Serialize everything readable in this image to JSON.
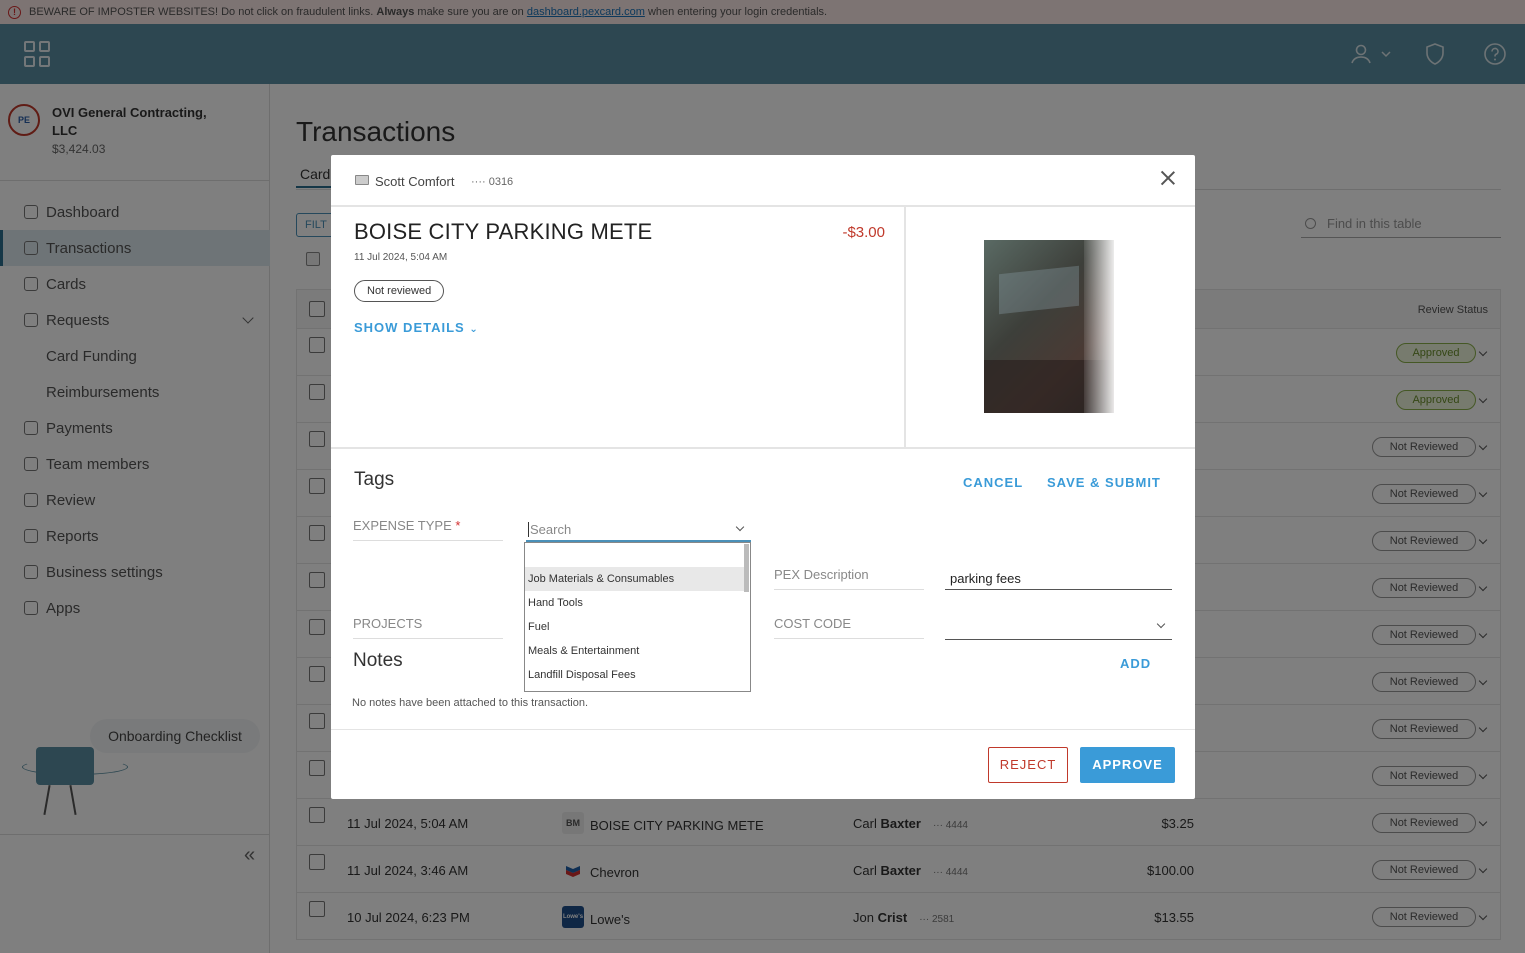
{
  "banner": {
    "prefix": "BEWARE OF IMPOSTER WEBSITES! Do not click on fraudulent links.",
    "always": "Always",
    "middle": "make sure you are on",
    "link": "dashboard.pexcard.com",
    "suffix": "when entering your login credentials."
  },
  "org": {
    "name": "OVI General Contracting, LLC",
    "balance": "$3,424.03",
    "logo_text": "PE"
  },
  "nav": {
    "items": [
      {
        "label": "Dashboard"
      },
      {
        "label": "Transactions"
      },
      {
        "label": "Cards"
      },
      {
        "label": "Requests"
      },
      {
        "label": "Card Funding"
      },
      {
        "label": "Reimbursements"
      },
      {
        "label": "Payments"
      },
      {
        "label": "Team members"
      },
      {
        "label": "Review"
      },
      {
        "label": "Reports"
      },
      {
        "label": "Business settings"
      },
      {
        "label": "Apps"
      }
    ],
    "onboarding": "Onboarding Checklist"
  },
  "page": {
    "title": "Transactions",
    "tab": "Card",
    "filter": "FILT",
    "find_placeholder": "Find in this table",
    "review_status_header": "Review Status"
  },
  "rows": [
    {
      "status": "Approved"
    },
    {
      "status": "Approved"
    },
    {
      "status": "Not Reviewed"
    },
    {
      "status": "Not Reviewed"
    },
    {
      "status": "Not Reviewed"
    },
    {
      "status": "Not Reviewed"
    },
    {
      "status": "Not Reviewed"
    },
    {
      "status": "Not Reviewed"
    },
    {
      "status": "Not Reviewed"
    },
    {
      "status": "Not Reviewed"
    },
    {
      "date": "11 Jul 2024, 5:04 AM",
      "merchant_icon": "BM",
      "merchant": "BOISE CITY PARKING METE",
      "first": "Carl",
      "last": "Baxter",
      "card": "··· 4444",
      "amount": "$3.25",
      "status": "Not Reviewed"
    },
    {
      "date": "11 Jul 2024, 3:46 AM",
      "merchant_icon": "",
      "merchant": "Chevron",
      "first": "Carl",
      "last": "Baxter",
      "card": "··· 4444",
      "amount": "$100.00",
      "status": "Not Reviewed"
    },
    {
      "date": "10 Jul 2024, 6:23 PM",
      "merchant_icon": "Lowe's",
      "merchant": "Lowe's",
      "first": "Jon",
      "last": "Crist",
      "card": "··· 2581",
      "amount": "$13.55",
      "status": "Not Reviewed"
    }
  ],
  "modal": {
    "cardholder": "Scott Comfort",
    "card_last4": "···· 0316",
    "merchant": "BOISE CITY PARKING METE",
    "amount": "-$3.00",
    "date": "11 Jul 2024, 5:04 AM",
    "review_pill": "Not reviewed",
    "show_details": "SHOW DETAILS",
    "tags_heading": "Tags",
    "cancel": "CANCEL",
    "save_submit": "SAVE & SUBMIT",
    "expense_type_label": "EXPENSE TYPE",
    "required_mark": "*",
    "search_placeholder": "Search",
    "dropdown_options": [
      "",
      "Job Materials & Consumables",
      "Hand Tools",
      "Fuel",
      "Meals & Entertainment",
      "Landfill Disposal Fees"
    ],
    "pex_description_label": "PEX Description",
    "pex_description_value": "parking fees",
    "projects_label": "PROJECTS",
    "cost_code_label": "COST CODE",
    "notes_heading": "Notes",
    "add": "ADD",
    "no_notes": "No notes have been attached to this transaction.",
    "reject": "REJECT",
    "approve": "APPROVE"
  }
}
